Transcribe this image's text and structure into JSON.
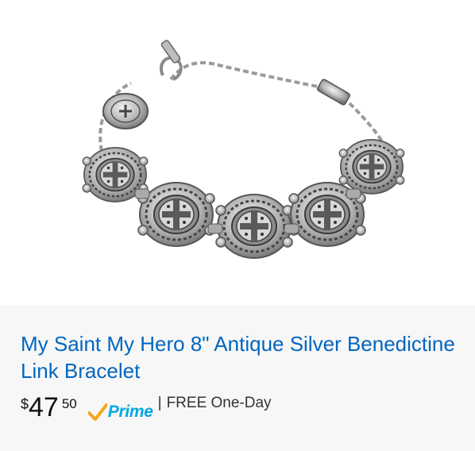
{
  "product": {
    "title": "My Saint My Hero 8\" Antique Silver Benedictine Link Bracelet",
    "price": {
      "symbol": "$",
      "whole": "47",
      "fraction": "50"
    },
    "prime_label": "Prime",
    "shipping_separator": "|",
    "shipping_text": "FREE One-Day",
    "image_alt": "antique-silver-medallion-bracelet"
  },
  "colors": {
    "title_link": "#0066c0",
    "prime_blue": "#00a8e1",
    "prime_check": "#f7a51c",
    "silver": "#9a9a9a"
  }
}
